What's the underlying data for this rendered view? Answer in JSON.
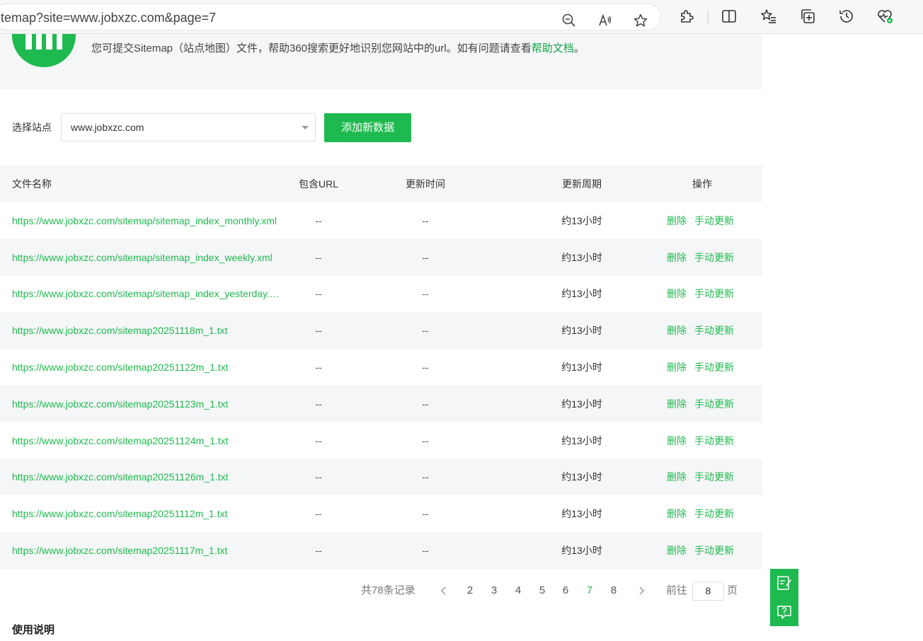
{
  "browser": {
    "address": "temap?site=www.jobxzc.com&page=7",
    "icons": [
      "zoom-out-icon",
      "read-aloud-icon",
      "favorite-star-icon",
      "extensions-icon",
      "split-screen-icon",
      "favorites-list-icon",
      "collections-icon",
      "history-icon",
      "browser-essentials-icon"
    ]
  },
  "banner": {
    "text_prefix": "您可提交Sitemap（站点地图）文件，帮助360搜索更好地识别您网站中的url。如有问题请查看",
    "help_link": "帮助文档",
    "text_suffix": "。"
  },
  "site_select": {
    "label": "选择站点",
    "value": "www.jobxzc.com"
  },
  "add_button": "添加新数据",
  "table": {
    "headers": {
      "name": "文件名称",
      "url": "包含URL",
      "time": "更新时间",
      "cycle": "更新周期",
      "ops": "操作"
    },
    "rows": [
      {
        "name": "https://www.jobxzc.com/sitemap/sitemap_index_monthly.xml",
        "url": "--",
        "time": "--",
        "cycle": "约13小时"
      },
      {
        "name": "https://www.jobxzc.com/sitemap/sitemap_index_weekly.xml",
        "url": "--",
        "time": "--",
        "cycle": "约13小时"
      },
      {
        "name": "https://www.jobxzc.com/sitemap/sitemap_index_yesterday.xml",
        "url": "--",
        "time": "--",
        "cycle": "约13小时"
      },
      {
        "name": "https://www.jobxzc.com/sitemap20251118m_1.txt",
        "url": "--",
        "time": "--",
        "cycle": "约13小时"
      },
      {
        "name": "https://www.jobxzc.com/sitemap20251122m_1.txt",
        "url": "--",
        "time": "--",
        "cycle": "约13小时"
      },
      {
        "name": "https://www.jobxzc.com/sitemap20251123m_1.txt",
        "url": "--",
        "time": "--",
        "cycle": "约13小时"
      },
      {
        "name": "https://www.jobxzc.com/sitemap20251124m_1.txt",
        "url": "--",
        "time": "--",
        "cycle": "约13小时"
      },
      {
        "name": "https://www.jobxzc.com/sitemap20251126m_1.txt",
        "url": "--",
        "time": "--",
        "cycle": "约13小时"
      },
      {
        "name": "https://www.jobxzc.com/sitemap20251112m_1.txt",
        "url": "--",
        "time": "--",
        "cycle": "约13小时"
      },
      {
        "name": "https://www.jobxzc.com/sitemap20251117m_1.txt",
        "url": "--",
        "time": "--",
        "cycle": "约13小时"
      }
    ],
    "op_delete": "删除",
    "op_update": "手动更新"
  },
  "pagination": {
    "total": "共78条记录",
    "pages": [
      "2",
      "3",
      "4",
      "5",
      "6",
      "7",
      "8"
    ],
    "current": "7",
    "goto_label": "前往",
    "goto_value": "8",
    "goto_suffix": "页"
  },
  "usage_title": "使用说明",
  "colors": {
    "accent": "#1fba4f",
    "panel_bg": "#f5f6f7"
  }
}
